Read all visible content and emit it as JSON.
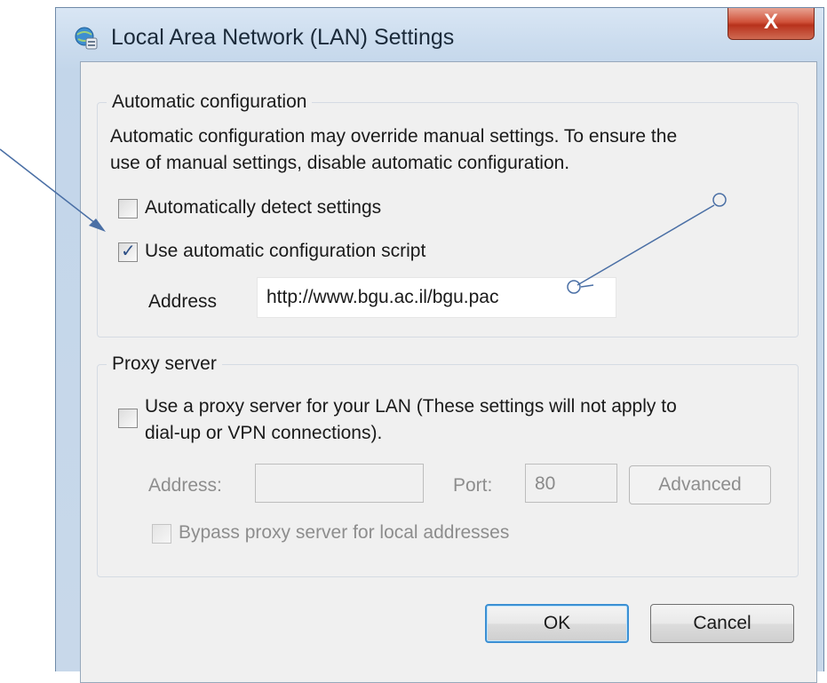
{
  "window": {
    "title": "Local Area Network (LAN) Settings",
    "close_label": "X"
  },
  "automatic": {
    "legend": "Automatic configuration",
    "description_line1": "Automatic configuration may override manual settings.  To ensure the",
    "description_line2": "use of manual settings, disable automatic configuration.",
    "detect_label": "Automatically detect settings",
    "detect_checked": false,
    "script_label": "Use automatic configuration script",
    "script_checked": true,
    "address_label": "Address",
    "address_value": "http://www.bgu.ac.il/bgu.pac"
  },
  "proxy": {
    "legend": "Proxy server",
    "use_proxy_line1": "Use a proxy server for your LAN (These settings will not apply to",
    "use_proxy_line2": "dial-up or VPN connections).",
    "use_proxy_checked": false,
    "address_label": "Address:",
    "address_value": "",
    "port_label": "Port:",
    "port_value": "80",
    "advanced_label": "Advanced",
    "bypass_label": "Bypass proxy server for local addresses",
    "bypass_checked": false
  },
  "buttons": {
    "ok_label": "OK",
    "cancel_label": "Cancel"
  },
  "colors": {
    "accent": "#3b8fd3",
    "arrow": "#4a6fa5",
    "close_button": "#c8432a"
  }
}
